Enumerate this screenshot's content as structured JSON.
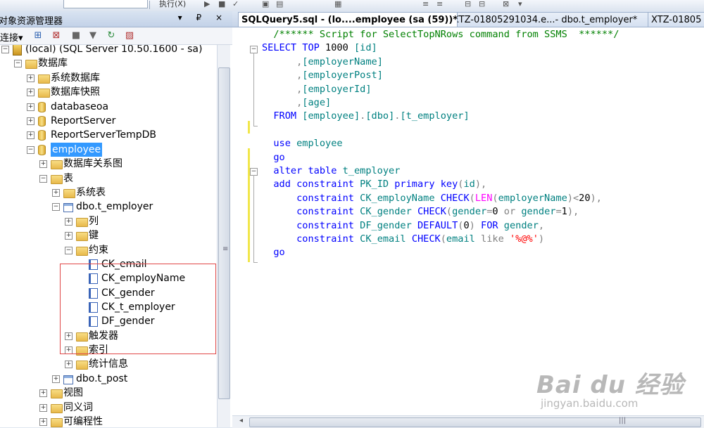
{
  "toolbar": {
    "execute_label": "执行(X)"
  },
  "object_explorer": {
    "title": "对象资源管理器",
    "title_buttons": "▾ ₽ ×",
    "connect_label": "连接▾",
    "tree": [
      {
        "label": "(local) (SQL Server 10.50.1600 - sa)",
        "icon": "server-icon",
        "expander": "−"
      },
      {
        "label": "数据库",
        "icon": "folder-icon",
        "expander": "−"
      },
      {
        "label": "系统数据库",
        "icon": "folder-icon",
        "expander": "+"
      },
      {
        "label": "数据库快照",
        "icon": "folder-icon",
        "expander": "+"
      },
      {
        "label": "databaseoa",
        "icon": "database-icon",
        "expander": "+"
      },
      {
        "label": "ReportServer",
        "icon": "database-icon",
        "expander": "+"
      },
      {
        "label": "ReportServerTempDB",
        "icon": "database-icon",
        "expander": "+"
      },
      {
        "label": "employee",
        "icon": "database-icon",
        "expander": "−",
        "selected": true
      },
      {
        "label": "数据库关系图",
        "icon": "folder-icon",
        "expander": "+"
      },
      {
        "label": "表",
        "icon": "folder-icon",
        "expander": "−"
      },
      {
        "label": "系统表",
        "icon": "folder-icon",
        "expander": "+"
      },
      {
        "label": "dbo.t_employer",
        "icon": "table-icon",
        "expander": "−"
      },
      {
        "label": "列",
        "icon": "folder-icon",
        "expander": "+"
      },
      {
        "label": "键",
        "icon": "folder-icon",
        "expander": "+"
      },
      {
        "label": "约束",
        "icon": "folder-icon",
        "expander": "−"
      },
      {
        "label": "CK_email",
        "icon": "constraint-icon",
        "expander": ""
      },
      {
        "label": "CK_employName",
        "icon": "constraint-icon",
        "expander": ""
      },
      {
        "label": "CK_gender",
        "icon": "constraint-icon",
        "expander": ""
      },
      {
        "label": "CK_t_employer",
        "icon": "constraint-icon",
        "expander": ""
      },
      {
        "label": "DF_gender",
        "icon": "default-constraint-icon",
        "expander": ""
      },
      {
        "label": "触发器",
        "icon": "folder-icon",
        "expander": "+"
      },
      {
        "label": "索引",
        "icon": "folder-icon",
        "expander": "+"
      },
      {
        "label": "统计信息",
        "icon": "folder-icon",
        "expander": "+"
      },
      {
        "label": "dbo.t_post",
        "icon": "table-icon",
        "expander": "+"
      },
      {
        "label": "视图",
        "icon": "folder-icon",
        "expander": "+"
      },
      {
        "label": "同义词",
        "icon": "folder-icon",
        "expander": "+"
      },
      {
        "label": "可编程性",
        "icon": "folder-icon",
        "expander": "+"
      }
    ]
  },
  "editor": {
    "tabs": [
      {
        "label": "SQLQuery5.sql - (lo....employee (sa (59))*",
        "active": true
      },
      {
        "label": "XTZ-01805291034.e...- dbo.t_employer*",
        "active": false
      },
      {
        "label": "XTZ-01805",
        "active": false
      }
    ],
    "code_lines": [
      [
        {
          "t": "  /****** Script for SelectTopNRows command from SSMS  ******/",
          "c": "cmt"
        }
      ],
      [
        {
          "t": "SELECT TOP ",
          "c": "kw"
        },
        {
          "t": "1000 ",
          "c": "num"
        },
        {
          "t": "[id]",
          "c": "ident"
        }
      ],
      [
        {
          "t": "      ",
          "c": "plain"
        },
        {
          "t": ",",
          "c": "op"
        },
        {
          "t": "[employerName]",
          "c": "ident"
        }
      ],
      [
        {
          "t": "      ",
          "c": "plain"
        },
        {
          "t": ",",
          "c": "op"
        },
        {
          "t": "[employerPost]",
          "c": "ident"
        }
      ],
      [
        {
          "t": "      ",
          "c": "plain"
        },
        {
          "t": ",",
          "c": "op"
        },
        {
          "t": "[employerId]",
          "c": "ident"
        }
      ],
      [
        {
          "t": "      ",
          "c": "plain"
        },
        {
          "t": ",",
          "c": "op"
        },
        {
          "t": "[age]",
          "c": "ident"
        }
      ],
      [
        {
          "t": "  FROM ",
          "c": "kw"
        },
        {
          "t": "[employee]",
          "c": "ident"
        },
        {
          "t": ".",
          "c": "op"
        },
        {
          "t": "[dbo]",
          "c": "ident"
        },
        {
          "t": ".",
          "c": "op"
        },
        {
          "t": "[t_employer]",
          "c": "ident"
        }
      ],
      [],
      [
        {
          "t": "  use ",
          "c": "kw"
        },
        {
          "t": "employee",
          "c": "ident"
        }
      ],
      [
        {
          "t": "  go",
          "c": "kw"
        }
      ],
      [
        {
          "t": "  alter table ",
          "c": "kw"
        },
        {
          "t": "t_employer",
          "c": "ident"
        }
      ],
      [
        {
          "t": "  add constraint ",
          "c": "kw"
        },
        {
          "t": "PK_ID ",
          "c": "ident"
        },
        {
          "t": "primary key",
          "c": "kw"
        },
        {
          "t": "(",
          "c": "op"
        },
        {
          "t": "id",
          "c": "ident"
        },
        {
          "t": "),",
          "c": "op"
        }
      ],
      [
        {
          "t": "      constraint ",
          "c": "kw"
        },
        {
          "t": "CK_employName ",
          "c": "ident"
        },
        {
          "t": "CHECK",
          "c": "kw"
        },
        {
          "t": "(",
          "c": "op"
        },
        {
          "t": "LEN",
          "c": "fn"
        },
        {
          "t": "(",
          "c": "op"
        },
        {
          "t": "employerName",
          "c": "ident"
        },
        {
          "t": ")<",
          "c": "op"
        },
        {
          "t": "20",
          "c": "num"
        },
        {
          "t": "),",
          "c": "op"
        }
      ],
      [
        {
          "t": "      constraint ",
          "c": "kw"
        },
        {
          "t": "CK_gender ",
          "c": "ident"
        },
        {
          "t": "CHECK",
          "c": "kw"
        },
        {
          "t": "(",
          "c": "op"
        },
        {
          "t": "gender",
          "c": "ident"
        },
        {
          "t": "=",
          "c": "op"
        },
        {
          "t": "0 ",
          "c": "num"
        },
        {
          "t": "or ",
          "c": "op"
        },
        {
          "t": "gender",
          "c": "ident"
        },
        {
          "t": "=",
          "c": "op"
        },
        {
          "t": "1",
          "c": "num"
        },
        {
          "t": "),",
          "c": "op"
        }
      ],
      [
        {
          "t": "      constraint ",
          "c": "kw"
        },
        {
          "t": "DF_gender ",
          "c": "ident"
        },
        {
          "t": "DEFAULT",
          "c": "kw"
        },
        {
          "t": "(",
          "c": "op"
        },
        {
          "t": "0",
          "c": "num"
        },
        {
          "t": ") ",
          "c": "op"
        },
        {
          "t": "FOR ",
          "c": "kw"
        },
        {
          "t": "gender",
          "c": "ident"
        },
        {
          "t": ",",
          "c": "op"
        }
      ],
      [
        {
          "t": "      constraint ",
          "c": "kw"
        },
        {
          "t": "CK_email ",
          "c": "ident"
        },
        {
          "t": "CHECK",
          "c": "kw"
        },
        {
          "t": "(",
          "c": "op"
        },
        {
          "t": "email ",
          "c": "ident"
        },
        {
          "t": "like ",
          "c": "op"
        },
        {
          "t": "'%@%'",
          "c": "str"
        },
        {
          "t": ")",
          "c": "op"
        }
      ],
      [
        {
          "t": "  go",
          "c": "kw"
        }
      ]
    ]
  },
  "watermark": {
    "main": "Bai du 经验",
    "sub": "jingyan.baidu.com"
  },
  "colors": {
    "selection": "#3399ff",
    "highlight_box": "#e04848",
    "keyword": "#0000ff",
    "comment": "#008000",
    "identifier": "#008080",
    "string": "#ff0000",
    "function": "#ff00ff"
  }
}
